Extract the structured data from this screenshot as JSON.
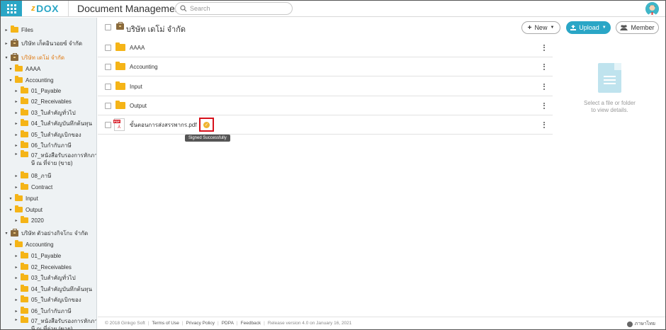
{
  "header": {
    "logo_z": "z",
    "logo_text": "DOX",
    "app_title": "Document Management",
    "search_placeholder": "Search"
  },
  "sidebar": {
    "items": [
      {
        "label": "Files",
        "caret": "▸",
        "icon": "folder-icon",
        "active": false
      },
      {
        "label": "บริษัท เก็ตอินวอยซ์ จำกัด",
        "caret": "▸",
        "icon": "briefcase-icon",
        "active": false
      },
      {
        "label": "บริษัท เดโม่ จำกัด",
        "caret": "▾",
        "icon": "briefcase-icon",
        "active": true
      },
      {
        "label": "AAAA",
        "caret": "▾",
        "icon": "folder-icon",
        "active": false
      },
      {
        "label": "Accounting",
        "caret": "▾",
        "icon": "folder-icon",
        "active": false
      },
      {
        "label": "01_Payable",
        "caret": "▸",
        "icon": "folder-icon",
        "active": false
      },
      {
        "label": "02_Receivables",
        "caret": "▸",
        "icon": "folder-icon",
        "active": false
      },
      {
        "label": "03_ใบสำคัญทั่วไป",
        "caret": "▸",
        "icon": "folder-icon",
        "active": false
      },
      {
        "label": "04_ใบสำคัญบันทึกต้นทุน",
        "caret": "▸",
        "icon": "folder-icon",
        "active": false
      },
      {
        "label": "05_ใบสำคัญเบิกของ",
        "caret": "▸",
        "icon": "folder-icon",
        "active": false
      },
      {
        "label": "06_ใบกำกับภาษี",
        "caret": "▸",
        "icon": "folder-icon",
        "active": false
      },
      {
        "label": "07_หนังสือรับรองการหักภา",
        "label2": "ษี ณ ที่จ่าย (ขาย)",
        "caret": "▸",
        "icon": "folder-icon",
        "active": false
      },
      {
        "label": "08_ภาษี",
        "caret": "▸",
        "icon": "folder-icon",
        "active": false
      },
      {
        "label": "Contract",
        "caret": "▸",
        "icon": "folder-icon",
        "active": false
      },
      {
        "label": "Input",
        "caret": "▾",
        "icon": "folder-icon",
        "active": false
      },
      {
        "label": "Output",
        "caret": "▾",
        "icon": "folder-icon",
        "active": false
      },
      {
        "label": "2020",
        "caret": "▸",
        "icon": "folder-icon",
        "active": false
      },
      {
        "label": "บริษัท ตัวอย่างกิจโกะ จำกัด",
        "caret": "▾",
        "icon": "briefcase-icon",
        "active": false
      },
      {
        "label": "Accounting",
        "caret": "▾",
        "icon": "folder-icon",
        "active": false
      },
      {
        "label": "01_Payable",
        "caret": "▸",
        "icon": "folder-icon",
        "active": false
      },
      {
        "label": "02_Receivables",
        "caret": "▸",
        "icon": "folder-icon",
        "active": false
      },
      {
        "label": "03_ใบสำคัญทั่วไป",
        "caret": "▸",
        "icon": "folder-icon",
        "active": false
      },
      {
        "label": "04_ใบสำคัญบันทึกต้นทุน",
        "caret": "▸",
        "icon": "folder-icon",
        "active": false
      },
      {
        "label": "05_ใบสำคัญเบิกของ",
        "caret": "▸",
        "icon": "folder-icon",
        "active": false
      },
      {
        "label": "06_ใบกำกับภาษี",
        "caret": "▸",
        "icon": "folder-icon",
        "active": false
      },
      {
        "label": "07_หนังสือรับรองการหักภา",
        "label2": "ษี ณ ที่จ่าย (ขาย)",
        "caret": "▸",
        "icon": "folder-icon",
        "active": false
      }
    ]
  },
  "main": {
    "breadcrumb_title": "บริษัท เดโม่ จำกัด",
    "new_label": "New",
    "upload_label": "Upload",
    "member_label": "Member",
    "rows": [
      {
        "name": "AAAA",
        "type": "folder"
      },
      {
        "name": "Accounting",
        "type": "folder"
      },
      {
        "name": "Input",
        "type": "folder"
      },
      {
        "name": "Output",
        "type": "folder"
      },
      {
        "name": "ขั้นตอนการส่งสรรพากร.pdf",
        "type": "pdf"
      }
    ],
    "pdf_badge": "PDF",
    "tooltip": "Signed Successfully"
  },
  "detail": {
    "text_line1": "Select a file or folder",
    "text_line2": "to view details."
  },
  "footer": {
    "copyright": "© 2018 Ginkgo Soft",
    "terms": "Terms of Use",
    "privacy": "Privacy Policy",
    "pdpa": "PDPA",
    "feedback": "Feedback",
    "release": "Release version 4.0 on January 16, 2021",
    "language": "ภาษาไทย"
  },
  "colors": {
    "accent": "#2aa6c6",
    "folder": "#f5b417",
    "active_text": "#e07b14",
    "highlight_box": "#d7101a"
  }
}
